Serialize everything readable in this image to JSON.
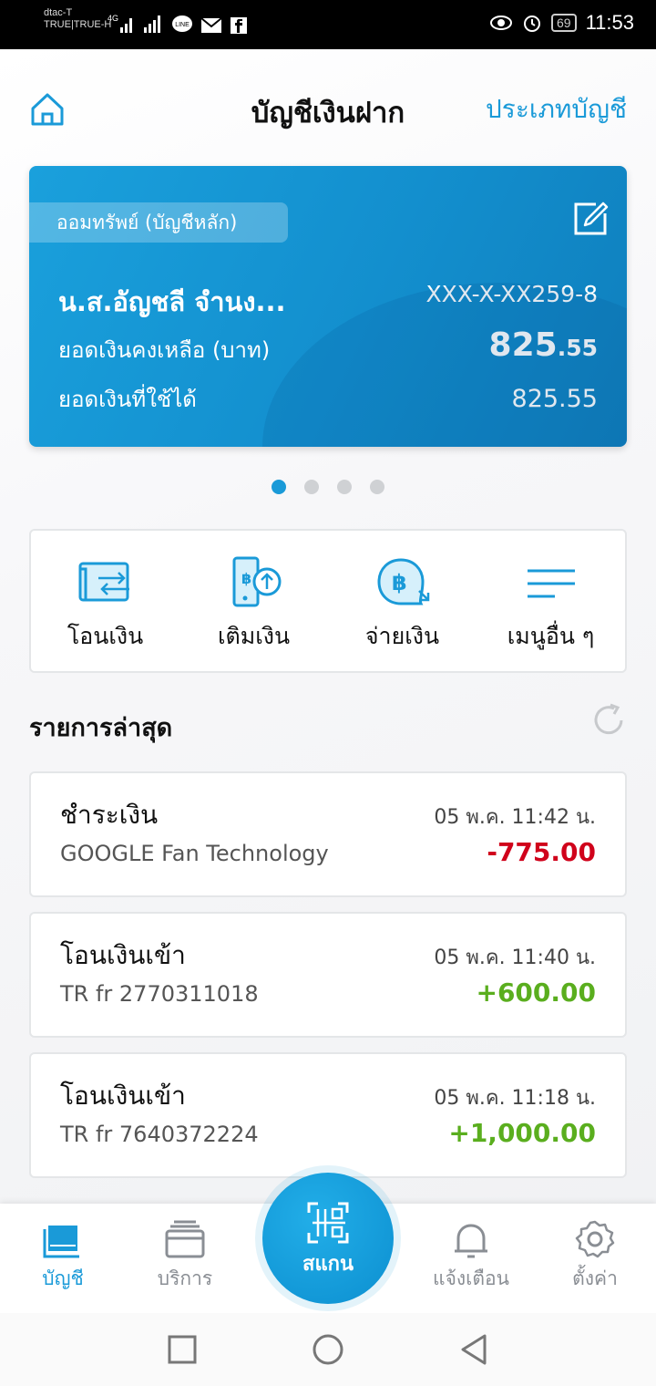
{
  "status_bar": {
    "carrier_line1": "dtac-T",
    "carrier_line2": "TRUE|TRUE-H",
    "network": "4G",
    "battery": "69",
    "time": "11:53"
  },
  "header": {
    "title": "บัญชีเงินฝาก",
    "account_type_link": "ประเภทบัญชี"
  },
  "account_card": {
    "badge": "ออมทรัพย์ (บัญชีหลัก)",
    "name": "น.ส.อัญชลี จำนง...",
    "account_number": "XXX-X-XX259-8",
    "balance_label": "ยอดเงินคงเหลือ (บาท)",
    "balance_int": "825",
    "balance_dec": ".55",
    "available_label": "ยอดเงินที่ใช้ได้",
    "available_value": "825.55",
    "page_count": 4,
    "active_page": 1
  },
  "quick_actions": [
    {
      "label": "โอนเงิน",
      "icon": "transfer-icon"
    },
    {
      "label": "เติมเงิน",
      "icon": "topup-icon"
    },
    {
      "label": "จ่ายเงิน",
      "icon": "pay-icon"
    },
    {
      "label": "เมนูอื่น ๆ",
      "icon": "menu-icon"
    }
  ],
  "recent": {
    "title": "รายการล่าสุด",
    "transactions": [
      {
        "type": "ชำระเงิน",
        "date": "05 พ.ค. 11:42 น.",
        "desc": "GOOGLE Fan Technology",
        "amount": "-775.00",
        "color": "#d0021b"
      },
      {
        "type": "โอนเงินเข้า",
        "date": "05 พ.ค. 11:40 น.",
        "desc": "TR fr 2770311018",
        "amount": "+600.00",
        "color": "#5aae1e"
      },
      {
        "type": "โอนเงินเข้า",
        "date": "05 พ.ค. 11:18 น.",
        "desc": "TR fr 7640372224",
        "amount": "+1,000.00",
        "color": "#5aae1e"
      }
    ]
  },
  "tab_bar": {
    "accounts": "บัญชี",
    "services": "บริการ",
    "scan": "สแกน",
    "notifications": "แจ้งเตือน",
    "settings": "ตั้งค่า"
  },
  "colors": {
    "accent": "#1a9ad8",
    "negative": "#d0021b",
    "positive": "#5aae1e"
  }
}
